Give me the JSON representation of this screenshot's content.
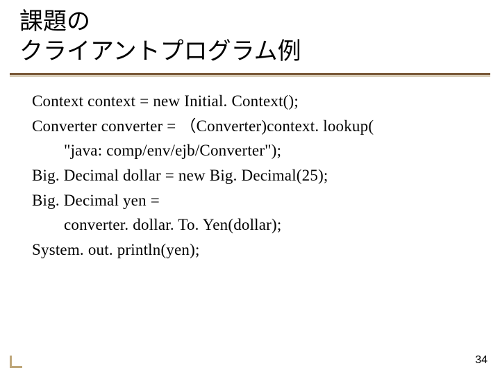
{
  "title": {
    "line1": "課題の",
    "line2": "クライアントプログラム例"
  },
  "code": {
    "l1": "Context context = new Initial. Context();",
    "l2": "Converter converter = （Converter)context. lookup(",
    "l3": "\"java: comp/env/ejb/Converter\");",
    "l4": "Big. Decimal dollar = new Big. Decimal(25);",
    "l5": "Big. Decimal yen =",
    "l6": "converter. dollar. To. Yen(dollar);",
    "l7": "System. out. println(yen);"
  },
  "page_number": "34"
}
